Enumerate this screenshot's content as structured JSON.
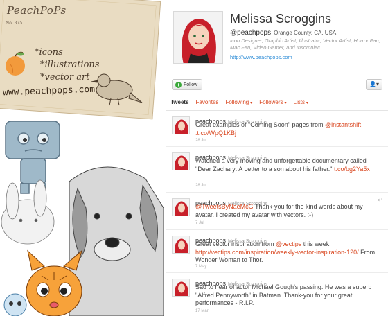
{
  "card": {
    "logo": "PeachPoPs",
    "number": "No. 375",
    "lines": [
      "*icons",
      "*illustrations",
      "*vector art"
    ],
    "url": "www.peachpops.com"
  },
  "profile": {
    "name": "Melissa Scroggins",
    "handle": "@peachpops",
    "location": "Orange County, CA, USA",
    "bio": "Icon Designer, Graphic Artist, Illustrator, Vector Artist, Horror Fan, Mac Fan, Video Gamer, and Insomniac.",
    "website": "http://www.peachpops.com"
  },
  "actions": {
    "follow_label": "Follow",
    "user_menu_label": "▾"
  },
  "tabs": [
    {
      "label": "Tweets",
      "active": true
    },
    {
      "label": "Favorites"
    },
    {
      "label": "Following",
      "caret": "▾"
    },
    {
      "label": "Followers",
      "caret": "▾"
    },
    {
      "label": "Lists",
      "caret": "▾"
    }
  ],
  "tweets": [
    {
      "user": "peachpops",
      "real_name": "Melissa Scroggins",
      "text_before": "Great examples of \"Coming Soon\" pages from ",
      "mention": "@instantshift",
      "text_mid": " ",
      "link": ":t.co/WpQ1KBj",
      "text_after": "",
      "time": "28 Jul"
    },
    {
      "user": "peachpops",
      "real_name": "Melissa Scroggins",
      "text_before": "Watched a very moving and unforgettable documentary called \"Dear Zachary: A Letter to a son about his father.\" ",
      "mention": "",
      "text_mid": "",
      "link": "t.co/bg2Ya5x",
      "text_after": "",
      "time": "28 Jul"
    },
    {
      "user": "peachpops",
      "real_name": "Melissa Scroggins",
      "text_before": "",
      "mention": "@TweetsByNaeMcG",
      "text_mid": " Thank-you for the kind words about my avatar. I created my avatar with vectors. :-)",
      "link": "",
      "text_after": "",
      "time": "7 Jul",
      "reply": "↩"
    },
    {
      "user": "peachpops",
      "real_name": "Melissa Scroggins",
      "text_before": "Great vector inspiration from ",
      "mention": "@vectips",
      "text_mid": " this week: ",
      "link": "http://vectips.com/inspiration/weekly-vector-inspiration-120/",
      "text_after": " From Wonder Woman to Thor.",
      "time": "7 May"
    },
    {
      "user": "peachpops",
      "real_name": "Melissa Scroggins",
      "text_before": "Sad to hear of actor Michael Gough's passing. He was a superb \"Alfred Pennyworth\" in Batman. Thank-you for your great performances - R.I.P.",
      "mention": "",
      "text_mid": "",
      "link": "",
      "text_after": "",
      "time": "17 Mar"
    }
  ],
  "colors": {
    "link": "#d9461f",
    "url_blue": "#2b8bd6",
    "card": "#e9dcc2",
    "peach": "#f29a3c"
  }
}
